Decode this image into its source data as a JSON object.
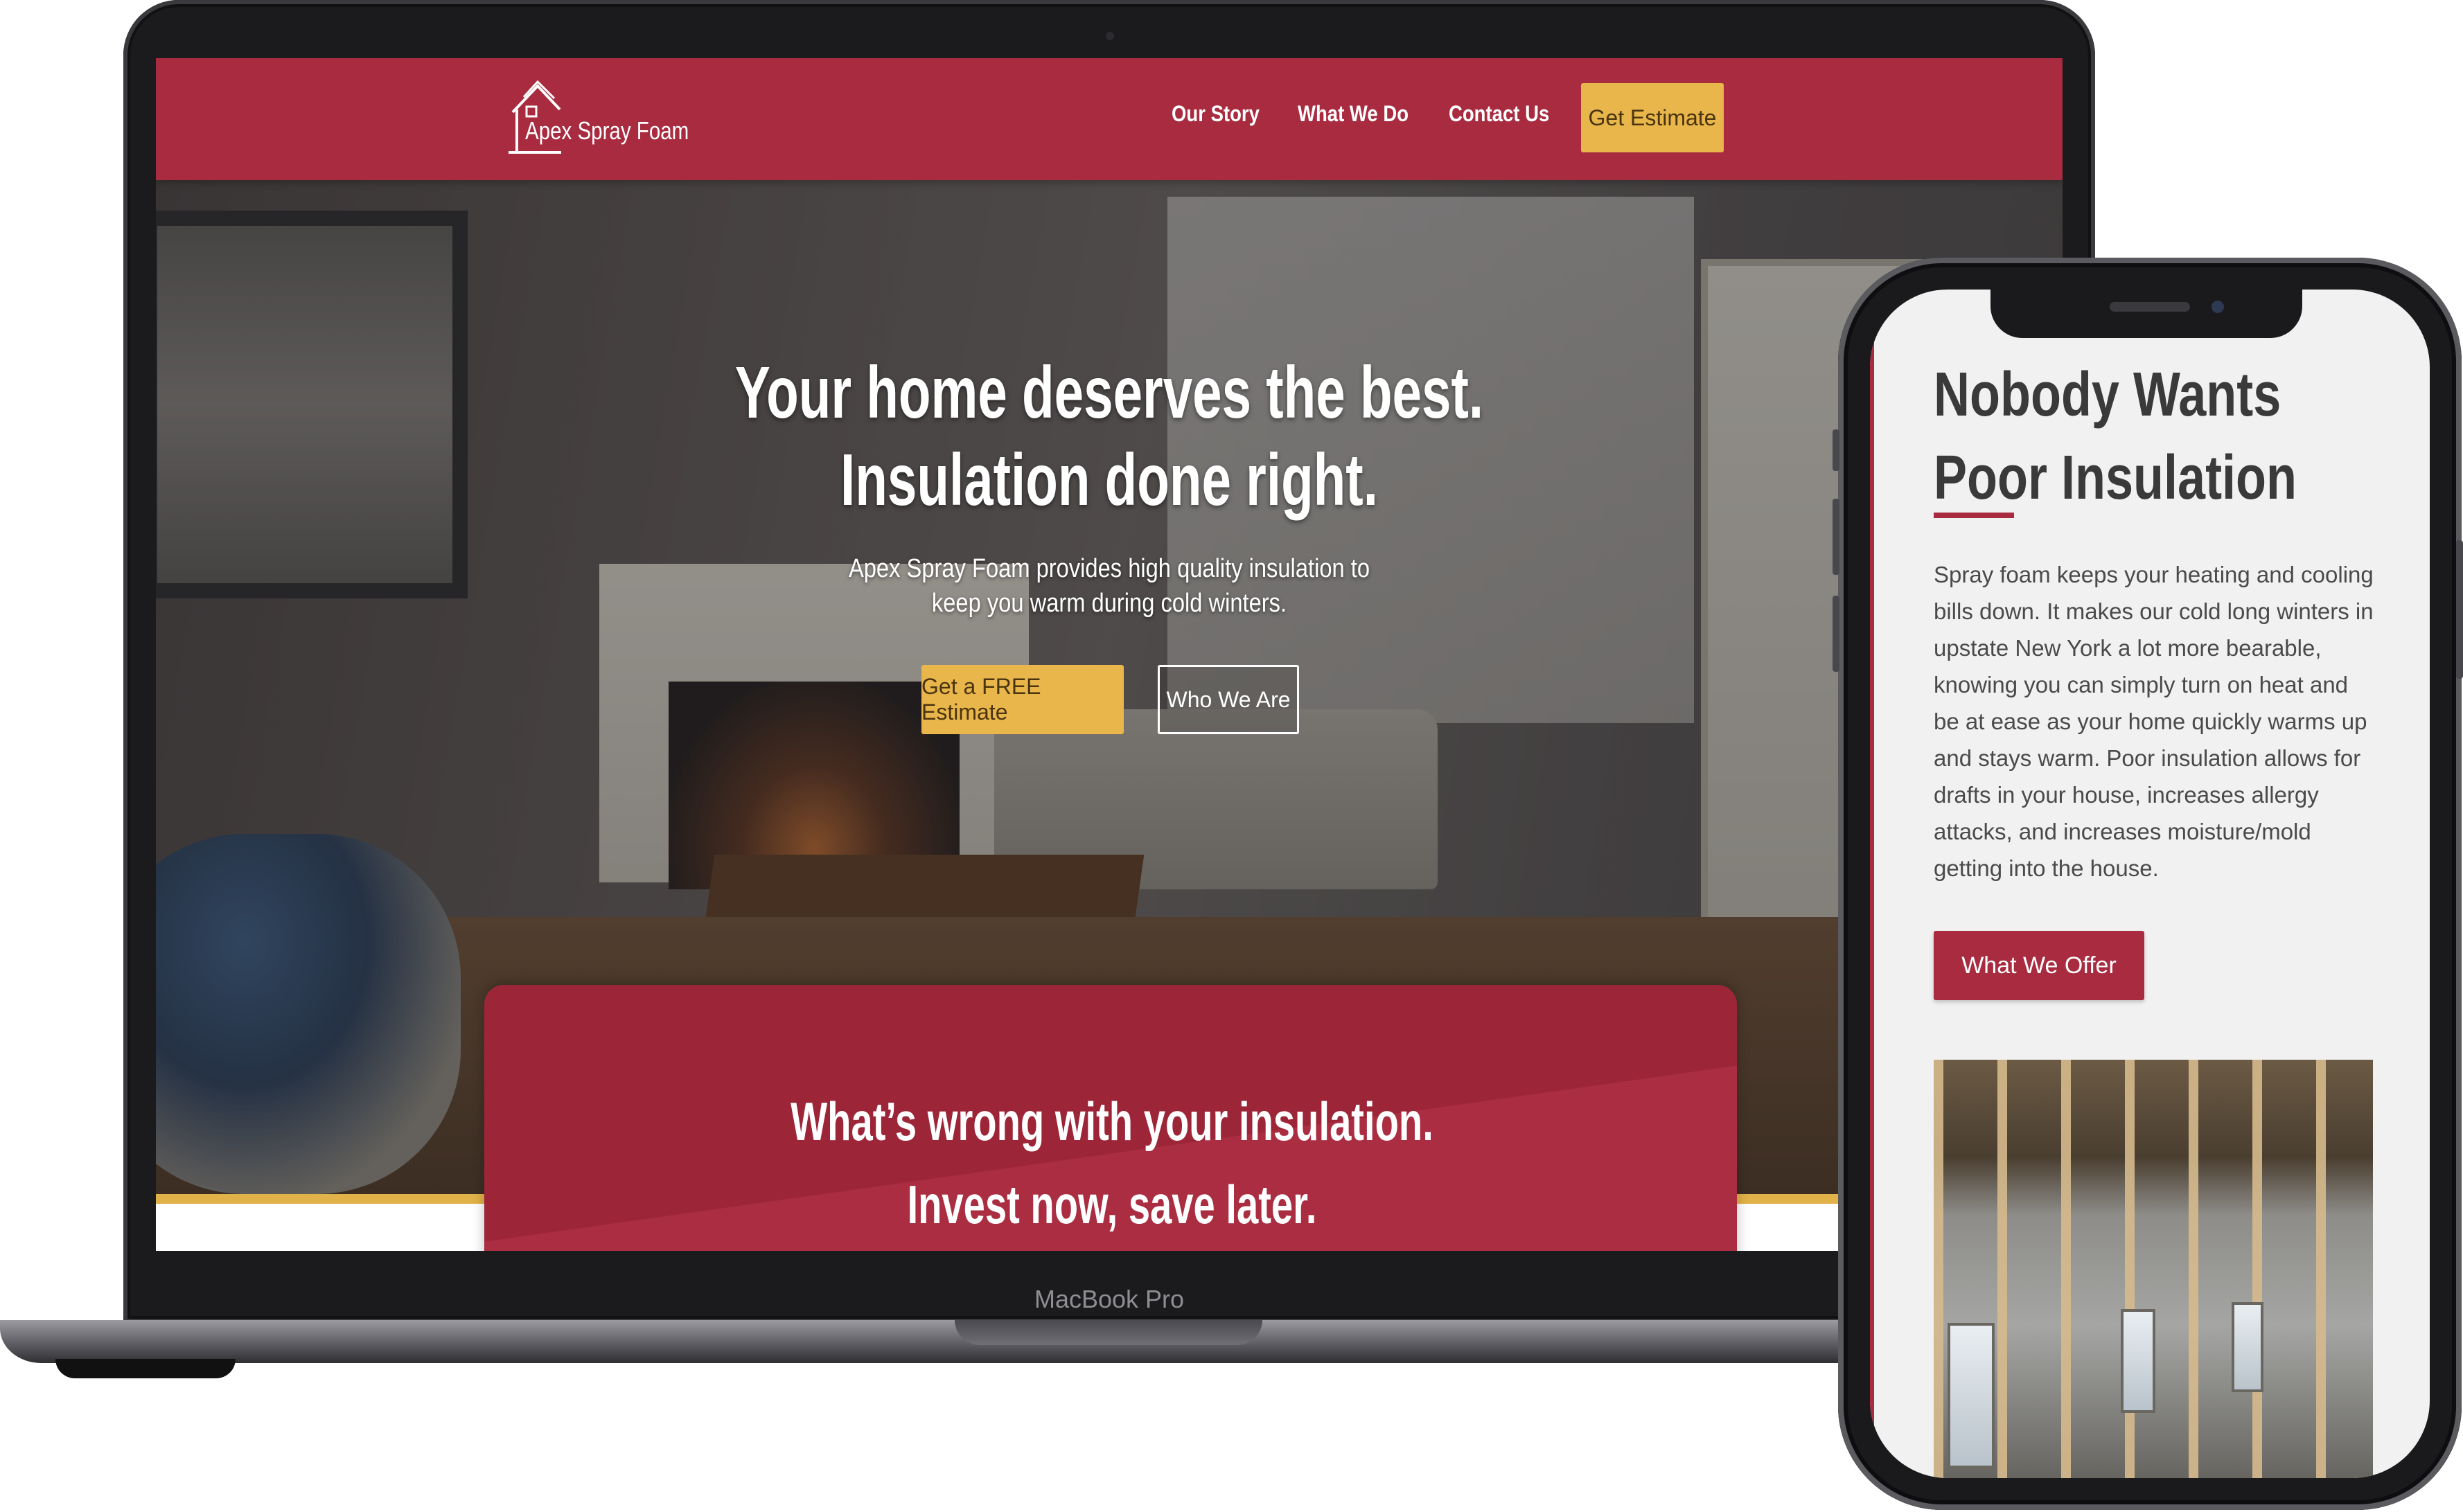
{
  "laptop": {
    "device_label": "MacBook Pro",
    "site": {
      "logo": "Apex Spray Foam",
      "nav": [
        "Our Story",
        "What We Do",
        "Contact Us"
      ],
      "nav_cta": "Get Estimate",
      "hero": {
        "title_line1": "Your home deserves the best.",
        "title_line2": "Insulation done right.",
        "subtitle_line1": "Apex Spray Foam provides high quality insulation to",
        "subtitle_line2": "keep you warm during cold winters.",
        "primary_button": "Get a FREE Estimate",
        "secondary_button": "Who We Are"
      },
      "section": {
        "line1": "What’s wrong with your insulation.",
        "line2": "Invest now, save later."
      }
    }
  },
  "phone": {
    "title": "Nobody Wants Poor Insulation",
    "body": "Spray foam keeps your heating and cooling bills down. It makes our cold long winters in upstate New York a lot more bearable, knowing you can simply turn on heat and be at ease as your home quickly warms up and stays warm. Poor insulation allows for drafts in your house, increases allergy attacks, and increases moisture/mold getting into the house.",
    "button": "What We Offer"
  },
  "colors": {
    "brand_red": "#a82b40",
    "brand_gold": "#e8b64a"
  }
}
